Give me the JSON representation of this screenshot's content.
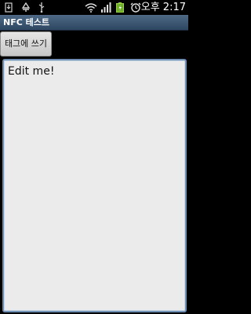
{
  "status_bar": {
    "time": "오후 2:17",
    "icons": [
      "download-icon",
      "recycle-icon",
      "usb-icon",
      "wifi-icon",
      "signal-icon",
      "battery-icon",
      "alarm-icon"
    ]
  },
  "app": {
    "title": "NFC 테스트"
  },
  "toolbar": {
    "write_label": "태그에 쓰기"
  },
  "editor": {
    "value": "Edit me!"
  },
  "colors": {
    "title_bar": "#3c5571",
    "edit_border": "#6e8fb3",
    "edit_background": "#ebebeb"
  }
}
